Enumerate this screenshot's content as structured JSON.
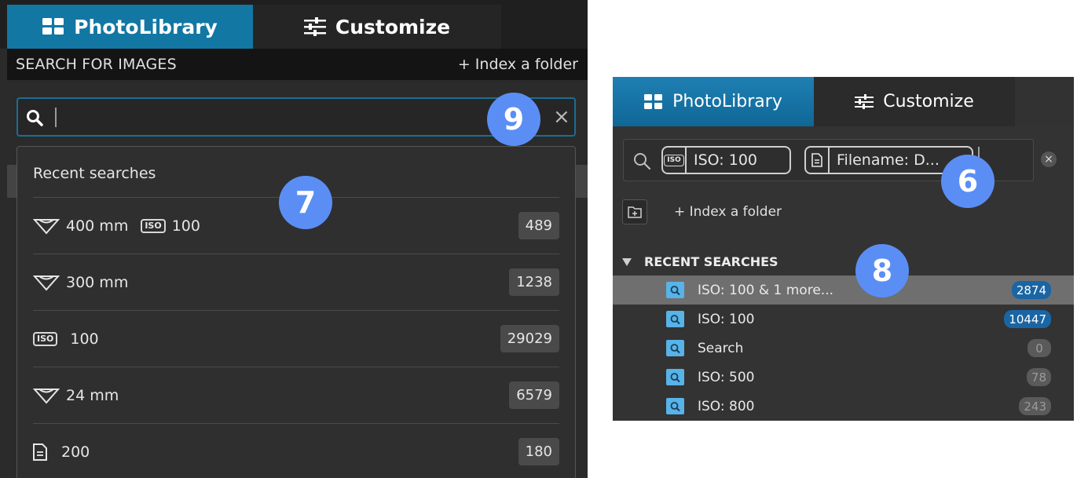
{
  "left_panel": {
    "tabs": {
      "photolibrary": "PhotoLibrary",
      "customize": "Customize"
    },
    "header": {
      "title": "SEARCH FOR IMAGES",
      "index_folder": "+ Index a folder"
    },
    "search": {
      "value": "",
      "clear_symbol": "×"
    },
    "callout_search": "9",
    "callout_dropdown": "7",
    "dropdown": {
      "title": "Recent searches",
      "rows": [
        {
          "icon": "lens-focal-icon",
          "text": "400 mm",
          "iso": "ISO",
          "iso_value": "100",
          "count": "489"
        },
        {
          "icon": "lens-focal-icon",
          "text": "300 mm",
          "count": "1238"
        },
        {
          "icon": "iso-icon",
          "iso": "ISO",
          "text": "100",
          "count": "29029"
        },
        {
          "icon": "lens-focal-icon",
          "text": "24 mm",
          "count": "6579"
        },
        {
          "icon": "file-icon",
          "text": "200",
          "count": "180"
        }
      ]
    }
  },
  "right_panel": {
    "tabs": {
      "photolibrary": "PhotoLibrary",
      "customize": "Customize"
    },
    "search": {
      "tokens": [
        {
          "icon": "iso-icon",
          "iso": "ISO",
          "text": "ISO: 100"
        },
        {
          "icon": "file-icon",
          "text": "Filename: D..."
        }
      ],
      "clear_symbol": "×"
    },
    "callout_search": "6",
    "index_folder": "+ Index a folder",
    "section_title": "RECENT SEARCHES",
    "callout_list": "8",
    "items": [
      {
        "label": "ISO: 100 & 1 more...",
        "count": "2874",
        "style": "blue",
        "selected": true
      },
      {
        "label": "ISO: 100",
        "count": "10447",
        "style": "blue",
        "selected": false
      },
      {
        "label": "Search",
        "count": "0",
        "style": "gray",
        "selected": false
      },
      {
        "label": "ISO: 500",
        "count": "78",
        "style": "gray",
        "selected": false
      },
      {
        "label": "ISO: 800",
        "count": "243",
        "style": "gray",
        "selected": false
      }
    ]
  },
  "colors": {
    "accent_blue": "#1277a3",
    "callout": "#5b8ef5",
    "folder_icon": "#57b3e8"
  }
}
